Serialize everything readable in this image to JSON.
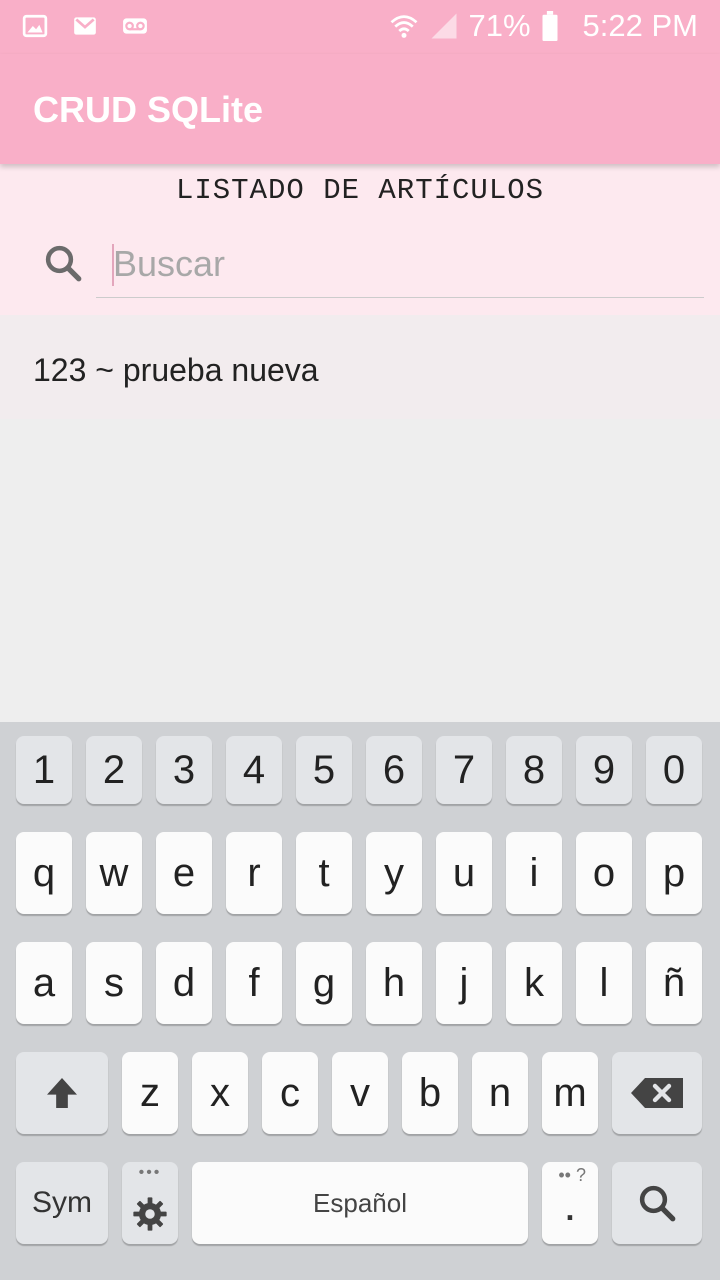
{
  "status_bar": {
    "battery": "71%",
    "time": "5:22 PM",
    "left_icons": [
      "image-icon",
      "gmail-icon",
      "voicemail-icon"
    ],
    "right_icons": [
      "wifi-icon",
      "signal-icon",
      "battery-icon"
    ]
  },
  "app_bar": {
    "title": "CRUD SQLite"
  },
  "main": {
    "section_title": "LISTADO DE ARTÍCULOS",
    "search": {
      "placeholder": "Buscar",
      "value": ""
    },
    "items": [
      {
        "label": "123 ~ prueba nueva"
      }
    ]
  },
  "keyboard": {
    "number_row": [
      "1",
      "2",
      "3",
      "4",
      "5",
      "6",
      "7",
      "8",
      "9",
      "0"
    ],
    "row1": [
      "q",
      "w",
      "e",
      "r",
      "t",
      "y",
      "u",
      "i",
      "o",
      "p"
    ],
    "row2": [
      "a",
      "s",
      "d",
      "f",
      "g",
      "h",
      "j",
      "k",
      "l",
      "ñ"
    ],
    "row3": [
      "z",
      "x",
      "c",
      "v",
      "b",
      "n",
      "m"
    ],
    "sym_label": "Sym",
    "space_label": "Español",
    "settings_dots": "•••",
    "period_hint": "•• ?",
    "period_label": "."
  },
  "colors": {
    "app_bar": "#f9afc8",
    "header_panel": "#fde9ef",
    "list_item_bg": "#f2ecee",
    "keyboard_bg": "#cfd1d4"
  }
}
